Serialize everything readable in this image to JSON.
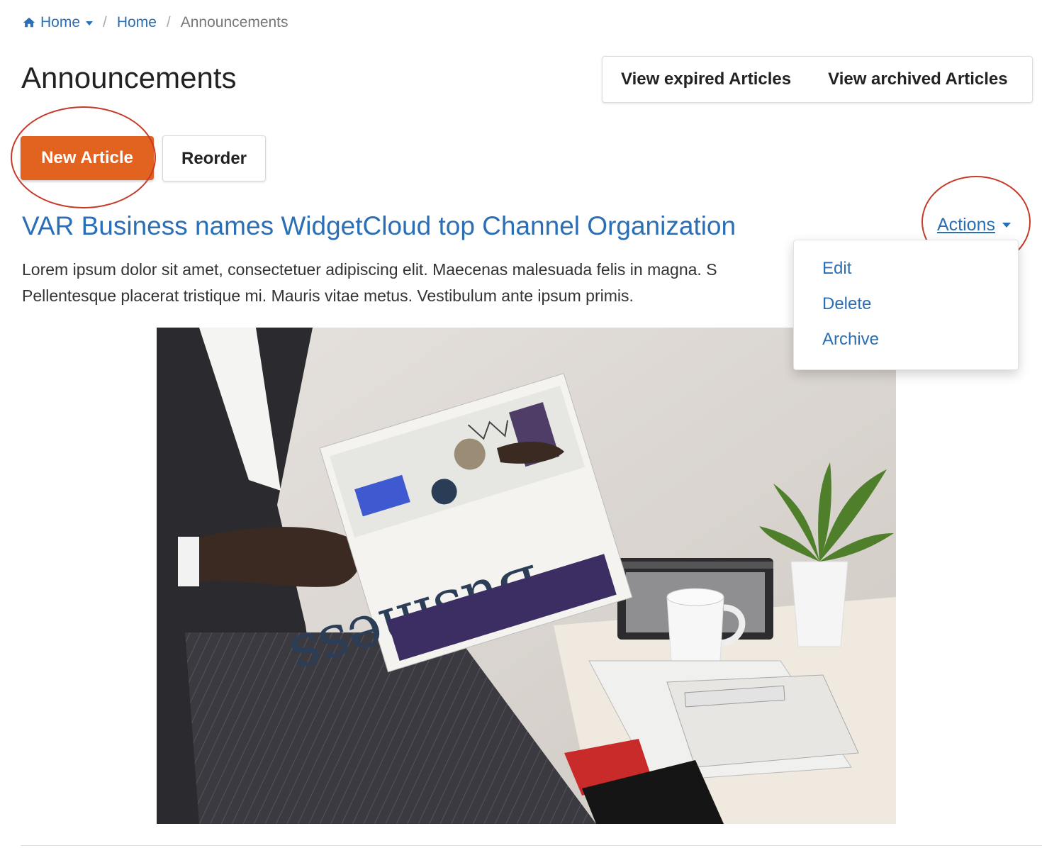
{
  "breadcrumb": {
    "home_menu_label": "Home",
    "home_link": "Home",
    "current": "Announcements",
    "separator": "/"
  },
  "page": {
    "title": "Announcements"
  },
  "toolbar": {
    "view_expired": "View expired Articles",
    "view_archived": "View archived Articles",
    "new_article": "New Article",
    "reorder": "Reorder"
  },
  "article": {
    "title": "VAR Business names WidgetCloud top Channel Organization",
    "body_line1": "Lorem ipsum dolor sit amet, consectetuer adipiscing elit. Maecenas malesuada felis in magna. S",
    "body_line2": "Pellentesque placerat tristique mi. Mauris vitae metus. Vestibulum ante ipsum primis.",
    "actions_label": "Actions",
    "image_headline": "Business"
  },
  "actions_menu": {
    "items": [
      {
        "label": "Edit"
      },
      {
        "label": "Delete"
      },
      {
        "label": "Archive"
      }
    ]
  },
  "colors": {
    "link": "#2a6fb5",
    "primary_button": "#e2621f",
    "annotation": "#c73a2a"
  },
  "icons": {
    "home": "home-icon",
    "caret": "caret-down-icon"
  }
}
